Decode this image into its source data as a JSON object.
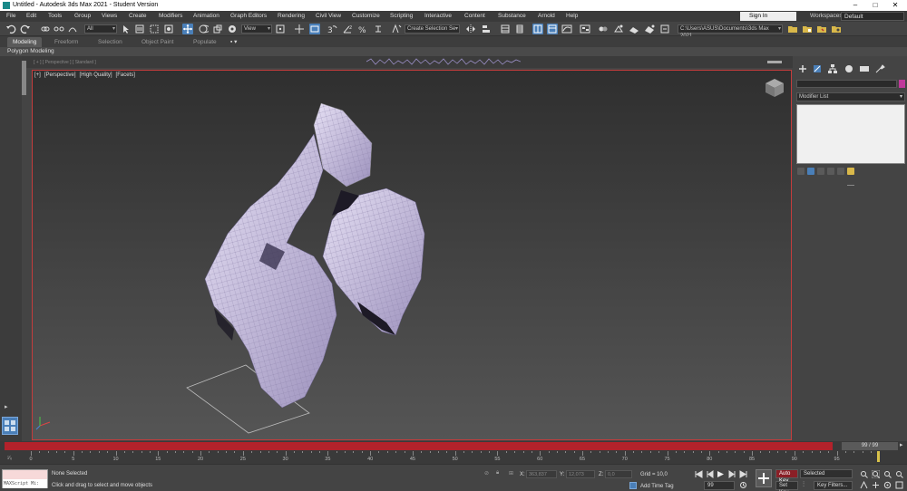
{
  "window": {
    "title": "Untitled - Autodesk 3ds Max 2021 - Student Version",
    "buttons": [
      "–",
      "□",
      "✕"
    ]
  },
  "menu": [
    "File",
    "Edit",
    "Tools",
    "Group",
    "Views",
    "Create",
    "Modifiers",
    "Animation",
    "Graph Editors",
    "Rendering",
    "Civil View",
    "Customize",
    "Scripting",
    "Interactive",
    "Content",
    "Substance",
    "Arnold",
    "Help"
  ],
  "account": {
    "sign_in": "Sign In",
    "workspaces_label": "Workspaces:",
    "workspace": "Default"
  },
  "toolbar": {
    "selection_filter": "All",
    "ref_coord": "View",
    "named_selection": "Create Selection Se",
    "project_path": "C:\\Users\\ASUS\\Documents\\3ds Max 2021",
    "angle_snap_label": "3",
    "snap_2_label": "2"
  },
  "ribbon": {
    "tabs": [
      "Modeling",
      "Freeform",
      "Selection",
      "Object Paint",
      "Populate"
    ],
    "active_tab": "Modeling",
    "panel_label": "Polygon Modeling"
  },
  "track": {
    "label": "[ + ] [ Perspective ] [ Standard ]"
  },
  "viewport": {
    "label_plus": "[+]",
    "label_view": "[Perspective]",
    "label_quality": "[High Quality]",
    "label_shading": "[Facets]",
    "mesh_color": "#c7bedf",
    "border_color": "#c43c3c"
  },
  "command_panel": {
    "modifier_list": "Modifier List",
    "color_swatch": "#c0399a"
  },
  "time": {
    "frame_indicator": "99 / 99",
    "ruler_labels": [
      "0",
      "5",
      "10",
      "15",
      "20",
      "25",
      "30",
      "35",
      "40",
      "45",
      "50",
      "55",
      "60",
      "65",
      "70",
      "75",
      "80",
      "85",
      "90",
      "95"
    ]
  },
  "status": {
    "maxscript_label": "MAXScript Mi:",
    "selection_status": "None Selected",
    "prompt": "Click and drag to select and move objects",
    "x_label": "X:",
    "x_value": "363,837",
    "y_label": "Y:",
    "y_value": "12,073",
    "z_label": "Z:",
    "z_value": "0,0",
    "grid": "Grid = 10,0",
    "add_time_tag": "Add Time Tag",
    "current_frame": "99",
    "auto_key": "Auto Key",
    "set_key": "Set Key",
    "key_filter_sel": "Selected",
    "key_filters": "Key Filters...",
    "accent_red": "#b3222b"
  }
}
